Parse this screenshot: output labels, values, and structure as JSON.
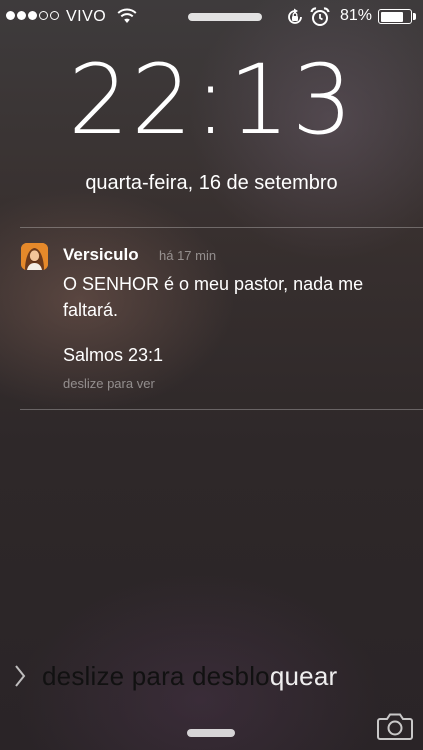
{
  "status_bar": {
    "signal_full": 3,
    "signal_total": 5,
    "carrier": "VIVO",
    "battery_percent": "81%",
    "battery_level": 0.81,
    "icons": [
      "wifi-icon",
      "rotation-lock-icon",
      "alarm-icon",
      "battery-icon"
    ]
  },
  "lock_screen": {
    "time": "22:13",
    "date": "quarta-feira, 16 de setembro"
  },
  "notification": {
    "app_name": "Versiculo",
    "time_ago": "há 17 min",
    "body": "O SENHOR é o meu pastor, nada me faltará.",
    "reference": "Salmos 23:1",
    "hint": "deslize para ver",
    "icon": "jesus-portrait-icon"
  },
  "unlock": {
    "text_dark": "deslize para desblo",
    "text_highlight": "quear",
    "icons": [
      "chevron-right-icon",
      "camera-icon"
    ]
  },
  "colors": {
    "notif_icon": "#e38a2e",
    "secondary_text": "#9a9495"
  }
}
